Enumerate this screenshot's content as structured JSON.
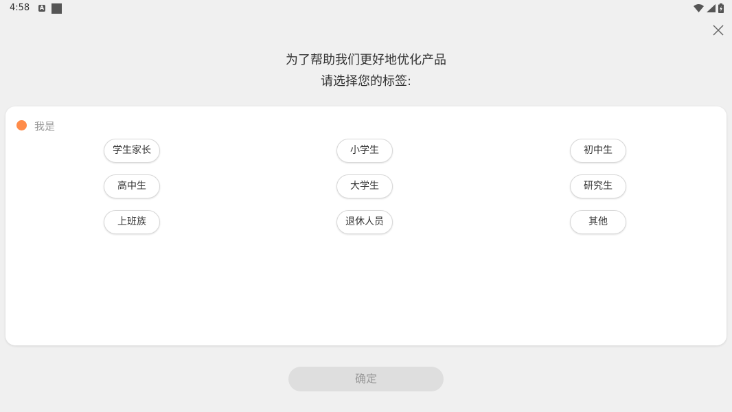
{
  "status_bar": {
    "time": "4:58",
    "left_icons": [
      "a-notification-icon",
      "square-notification-icon"
    ],
    "right_icons": [
      "wifi-icon",
      "signal-icon",
      "battery-icon"
    ]
  },
  "header": {
    "line1": "为了帮助我们更好地优化产品",
    "line2": "请选择您的标签:",
    "close_icon": "close-icon"
  },
  "section": {
    "label": "我是",
    "dot_color": "#ff8c4a",
    "options": [
      {
        "label": "学生家长"
      },
      {
        "label": "小学生"
      },
      {
        "label": "初中生"
      },
      {
        "label": "高中生"
      },
      {
        "label": "大学生"
      },
      {
        "label": "研究生"
      },
      {
        "label": "上班族"
      },
      {
        "label": "退休人员"
      },
      {
        "label": "其他"
      }
    ]
  },
  "confirm": {
    "label": "确定"
  }
}
